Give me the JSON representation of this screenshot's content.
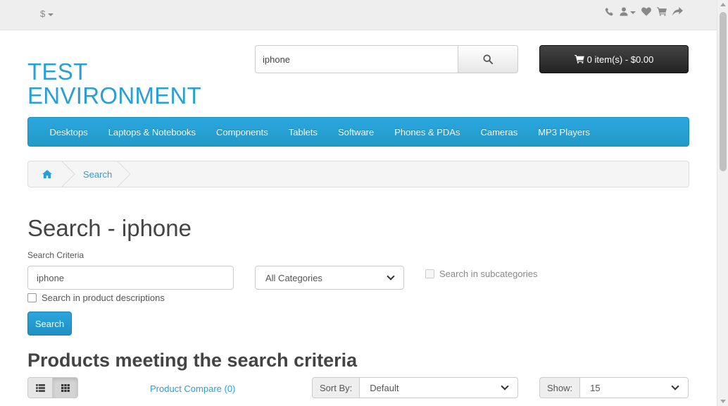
{
  "topbar": {
    "currency_symbol": "$",
    "icons": [
      "phone-icon",
      "user-icon",
      "heart-icon",
      "shopping-cart-icon",
      "share-icon"
    ]
  },
  "logo": {
    "line1": "TEST",
    "line2": "ENVIRONMENT"
  },
  "header_search": {
    "value": "iphone",
    "icon": "search-icon"
  },
  "cart": {
    "label": "0 item(s) - $0.00",
    "icon": "shopping-cart-icon"
  },
  "menu": {
    "items": [
      {
        "label": "Desktops"
      },
      {
        "label": "Laptops & Notebooks"
      },
      {
        "label": "Components"
      },
      {
        "label": "Tablets"
      },
      {
        "label": "Software"
      },
      {
        "label": "Phones & PDAs"
      },
      {
        "label": "Cameras"
      },
      {
        "label": "MP3 Players"
      }
    ]
  },
  "breadcrumb": {
    "home_icon": "home-icon",
    "current": "Search"
  },
  "page": {
    "title": "Search - iphone",
    "criteria_label": "Search Criteria",
    "criteria_value": "iphone",
    "category_selected": "All Categories",
    "subcategories_label": "Search in subcategories",
    "descriptions_label": "Search in product descriptions",
    "search_button": "Search",
    "products_title": "Products meeting the search criteria",
    "compare_link": "Product Compare (0)",
    "sort_label": "Sort By:",
    "sort_value": "Default",
    "show_label": "Show:",
    "show_value": "15"
  },
  "colors": {
    "accent": "#2a9fd6",
    "menu_bg": "#229ac8",
    "cart_bg": "#333333",
    "topbar_bg": "#eeeeee"
  }
}
